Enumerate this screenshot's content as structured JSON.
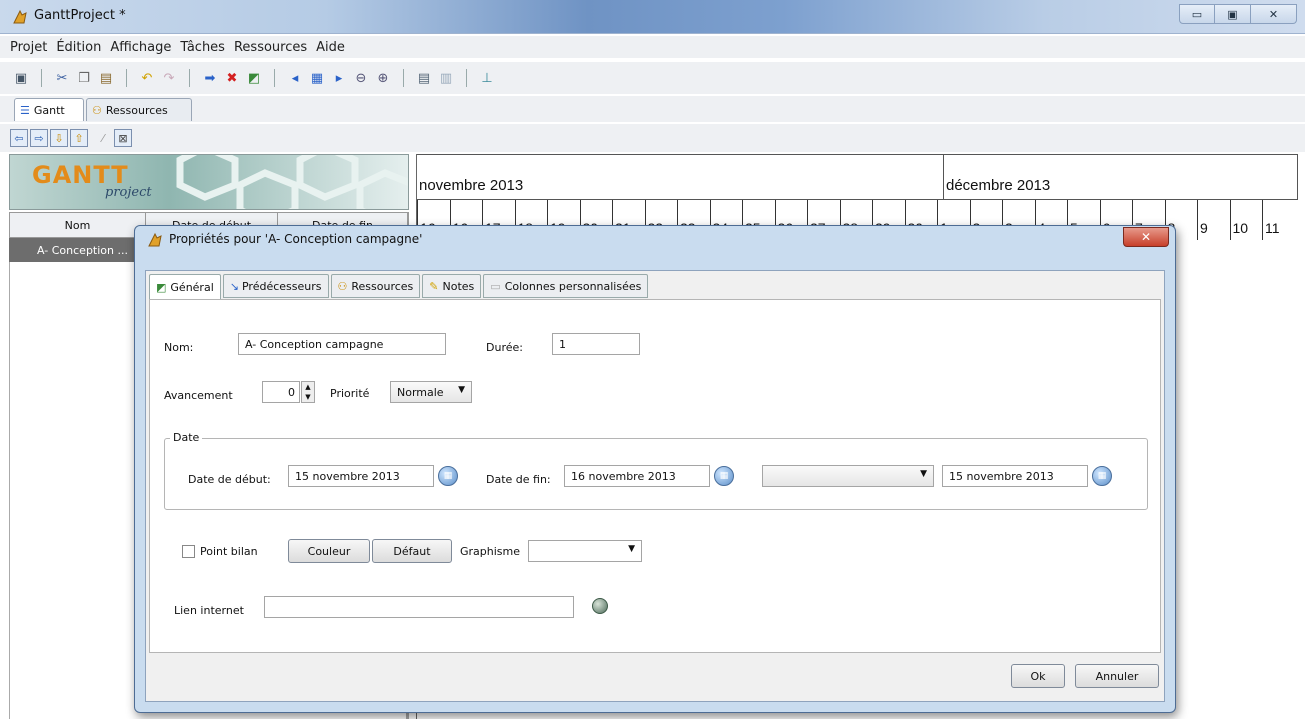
{
  "window": {
    "title": "GanttProject *",
    "controls": [
      "minimize",
      "maximize",
      "close"
    ]
  },
  "menu": [
    "Projet",
    "Édition",
    "Affichage",
    "Tâches",
    "Ressources",
    "Aide"
  ],
  "toolbar_icons": [
    "save-icon",
    "cut-icon",
    "copy-icon",
    "paste-icon",
    "undo-icon",
    "redo-icon",
    "indent-icon",
    "delete-icon",
    "properties-icon",
    "scroll-left-icon",
    "grid-icon",
    "scroll-right-icon",
    "zoom-out-icon",
    "zoom-in-icon",
    "print-icon",
    "export-icon",
    "chart-icon"
  ],
  "main_tabs": {
    "gantt": "Gantt",
    "resources": "Ressources"
  },
  "tree": {
    "logo_main": "GANTT",
    "logo_sub": "project",
    "columns": [
      "Nom",
      "Date de début",
      "Date de fin"
    ],
    "selected_row": "A- Conception ..."
  },
  "timeline": {
    "months": [
      "novembre 2013",
      "décembre 2013"
    ],
    "days": [
      "16",
      "16",
      "17",
      "18",
      "19",
      "20",
      "21",
      "22",
      "23",
      "24",
      "25",
      "26",
      "27",
      "28",
      "29",
      "30",
      "1",
      "2",
      "3",
      "4",
      "5",
      "6",
      "7",
      "8",
      "9",
      "10",
      "11"
    ]
  },
  "dialog": {
    "title": "Propriétés pour 'A- Conception campagne'",
    "tabs": [
      "Général",
      "Prédécesseurs",
      "Ressources",
      "Notes",
      "Colonnes personnalisées"
    ],
    "labels": {
      "name": "Nom:",
      "duration": "Durée:",
      "progress": "Avancement",
      "priority": "Priorité",
      "date_group": "Date",
      "start": "Date de début:",
      "end": "Date de fin:",
      "milestone": "Point bilan",
      "shape": "Graphisme",
      "link": "Lien internet"
    },
    "values": {
      "name": "A- Conception campagne",
      "duration": "1",
      "progress": "0",
      "priority": "Normale",
      "start": "15 novembre 2013",
      "end": "16 novembre 2013",
      "third_combo": "",
      "third_date": "15 novembre 2013",
      "shape": "",
      "link": ""
    },
    "buttons": {
      "color": "Couleur",
      "default": "Défaut",
      "ok": "Ok",
      "cancel": "Annuler"
    }
  }
}
